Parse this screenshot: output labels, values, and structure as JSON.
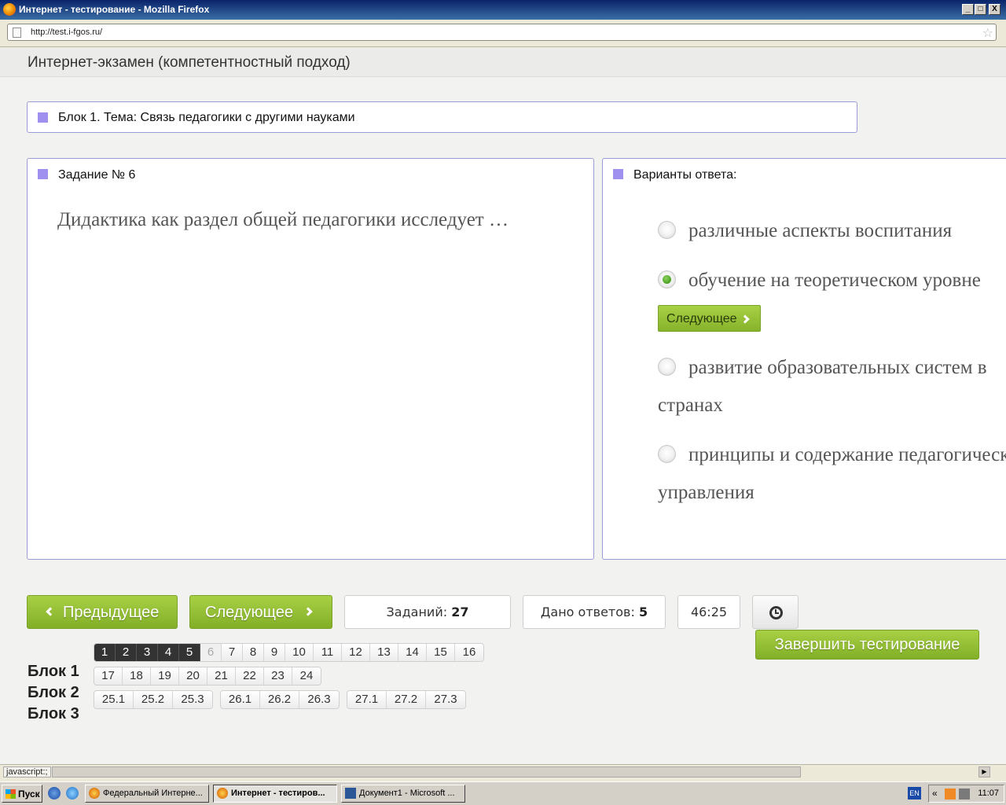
{
  "window": {
    "title": "Интернет - тестирование - Mozilla Firefox",
    "minimize": "_",
    "maximize": "□",
    "close": "X"
  },
  "browser": {
    "url": "http://test.i-fgos.ru/",
    "status": "javascript:;"
  },
  "page": {
    "title": "Интернет-экзамен (компетентностный подход)",
    "block_topic": "Блок 1. Тема: Связь педагогики с другими науками"
  },
  "question": {
    "heading": "Задание № 6",
    "text": "Дидактика как раздел общей педагогики исследует …"
  },
  "answers": {
    "heading": "Варианты ответа:",
    "options": [
      {
        "line1": "различные аспекты воспитания",
        "line2": "",
        "selected": false
      },
      {
        "line1": "обучение на теоретическом уровне",
        "line2": "",
        "selected": true
      },
      {
        "line1": "развитие образовательных систем в",
        "line2": "странах",
        "selected": false
      },
      {
        "line1": "принципы и содержание педагогического",
        "line2": "управления",
        "selected": false
      }
    ],
    "next_inline": "Следующее"
  },
  "controls": {
    "prev": "Предыдущее",
    "next": "Следующее",
    "tasks_label": "Заданий:",
    "tasks_count": "27",
    "answered_label": "Дано ответов:",
    "answered_count": "5",
    "timer": "46:25",
    "finish": "Завершить тестирование"
  },
  "blocks": {
    "labels": [
      "Блок 1",
      "Блок 2",
      "Блок 3"
    ],
    "row1": [
      {
        "n": "1",
        "state": "done"
      },
      {
        "n": "2",
        "state": "done"
      },
      {
        "n": "3",
        "state": "done"
      },
      {
        "n": "4",
        "state": "done"
      },
      {
        "n": "5",
        "state": "done"
      },
      {
        "n": "6",
        "state": "current"
      },
      {
        "n": "7",
        "state": ""
      },
      {
        "n": "8",
        "state": ""
      },
      {
        "n": "9",
        "state": ""
      },
      {
        "n": "10",
        "state": ""
      },
      {
        "n": "11",
        "state": ""
      },
      {
        "n": "12",
        "state": ""
      },
      {
        "n": "13",
        "state": ""
      },
      {
        "n": "14",
        "state": ""
      },
      {
        "n": "15",
        "state": ""
      },
      {
        "n": "16",
        "state": ""
      }
    ],
    "row2": [
      "17",
      "18",
      "19",
      "20",
      "21",
      "22",
      "23",
      "24"
    ],
    "row3_groups": [
      [
        "25.1",
        "25.2",
        "25.3"
      ],
      [
        "26.1",
        "26.2",
        "26.3"
      ],
      [
        "27.1",
        "27.2",
        "27.3"
      ]
    ]
  },
  "taskbar": {
    "start": "Пуск",
    "tasks": [
      "Федеральный Интерне...",
      "Интернет - тестиров...",
      "Документ1 - Microsoft ..."
    ],
    "lang": "EN",
    "tray_arrow": "«",
    "time": "11:07"
  }
}
